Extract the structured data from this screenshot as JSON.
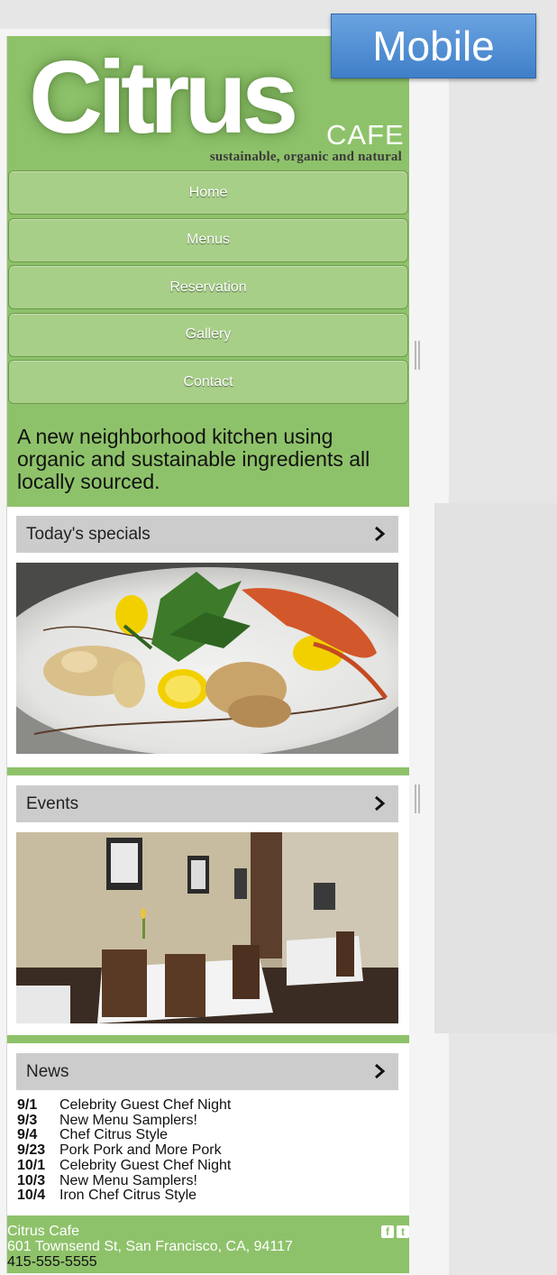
{
  "badge": {
    "label": "Mobile",
    "color": "#4a8ad4"
  },
  "brand": {
    "name": "Citrus",
    "suffix": "CAFE",
    "tagline": "sustainable, organic and natural",
    "accent": "#8ec26a"
  },
  "nav": {
    "items": [
      {
        "label": "Home"
      },
      {
        "label": "Menus"
      },
      {
        "label": "Reservation"
      },
      {
        "label": "Gallery"
      },
      {
        "label": "Contact"
      }
    ]
  },
  "intro": "A new neighborhood kitchen using organic and sustainable ingredients all locally sourced.",
  "sections": [
    {
      "title": "Today's specials",
      "icon": "chevron-right-icon"
    },
    {
      "title": "Events",
      "icon": "chevron-right-icon"
    },
    {
      "title": "News",
      "icon": "chevron-right-icon"
    }
  ],
  "news": [
    {
      "date": "9/1",
      "title": "Celebrity Guest Chef Night"
    },
    {
      "date": "9/3",
      "title": "New Menu Samplers!"
    },
    {
      "date": "9/4",
      "title": "Chef Citrus Style"
    },
    {
      "date": "9/23",
      "title": "Pork Pork and More Pork"
    },
    {
      "date": "10/1",
      "title": "Celebrity Guest Chef Night"
    },
    {
      "date": "10/3",
      "title": "New Menu Samplers!"
    },
    {
      "date": "10/4",
      "title": "Iron Chef Citrus Style"
    }
  ],
  "footer": {
    "name": "Citrus Cafe",
    "address": "601 Townsend St, San Francisco, CA, 94117",
    "phone": "415-555-5555",
    "social": [
      {
        "icon": "facebook-icon",
        "glyph": "f"
      },
      {
        "icon": "twitter-icon",
        "glyph": "t"
      }
    ]
  }
}
